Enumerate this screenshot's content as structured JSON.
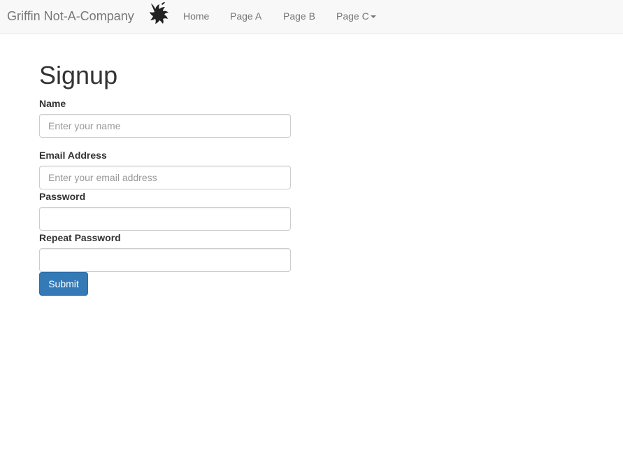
{
  "navbar": {
    "brand": "Griffin Not-A-Company",
    "logo_icon": "griffin-logo-icon",
    "links": [
      {
        "label": "Home"
      },
      {
        "label": "Page A"
      },
      {
        "label": "Page B"
      },
      {
        "label": "Page C",
        "dropdown": true,
        "icon": "caret-down-icon"
      }
    ]
  },
  "form": {
    "title": "Signup",
    "fields": {
      "name": {
        "label": "Name",
        "placeholder": "Enter your name",
        "value": ""
      },
      "email": {
        "label": "Email Address",
        "placeholder": "Enter your email address",
        "value": ""
      },
      "password": {
        "label": "Password",
        "placeholder": "",
        "value": ""
      },
      "repeat_password": {
        "label": "Repeat Password",
        "placeholder": "",
        "value": ""
      }
    },
    "submit_label": "Submit"
  },
  "colors": {
    "navbar_bg": "#f8f8f8",
    "nav_text": "#777777",
    "primary": "#337ab7",
    "input_border": "#cccccc"
  }
}
